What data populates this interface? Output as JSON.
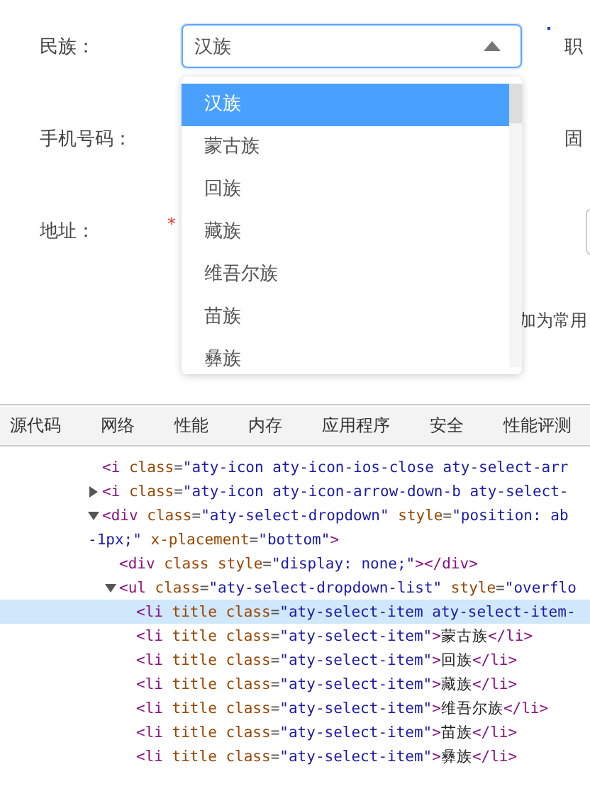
{
  "form": {
    "rows": [
      {
        "label": "民族：",
        "right_label": "职"
      },
      {
        "label": "手机号码：",
        "right_label": "固"
      },
      {
        "label": "地址：",
        "required_mark": "*"
      }
    ],
    "select": {
      "value": "汉族",
      "expanded": true,
      "options": [
        {
          "label": "汉族",
          "selected": true
        },
        {
          "label": "蒙古族",
          "selected": false
        },
        {
          "label": "回族",
          "selected": false
        },
        {
          "label": "藏族",
          "selected": false
        },
        {
          "label": "维吾尔族",
          "selected": false
        },
        {
          "label": "苗族",
          "selected": false
        },
        {
          "label": "彝族",
          "selected": false
        }
      ]
    },
    "hint_text": "加为常用"
  },
  "devtools": {
    "tabs": [
      {
        "label": "源代码",
        "selected": false
      },
      {
        "label": "网络",
        "selected": false
      },
      {
        "label": "性能",
        "selected": false
      },
      {
        "label": "内存",
        "selected": false
      },
      {
        "label": "应用程序",
        "selected": false
      },
      {
        "label": "安全",
        "selected": false
      },
      {
        "label": "性能评测",
        "selected": false
      }
    ],
    "dom_tree": [
      {
        "lines": [
          [
            {
              "kind": "tag",
              "text": "<i"
            },
            {
              "kind": "attr",
              "text": " class"
            },
            {
              "kind": "punct",
              "text": "="
            },
            {
              "kind": "value",
              "text": "\"aty-icon aty-icon-ios-close aty-select-arr"
            }
          ]
        ]
      },
      {
        "expanded": false,
        "lines": [
          [
            {
              "kind": "tag",
              "text": "<i"
            },
            {
              "kind": "attr",
              "text": " class"
            },
            {
              "kind": "punct",
              "text": "="
            },
            {
              "kind": "value",
              "text": "\"aty-icon aty-icon-arrow-down-b aty-select-"
            }
          ]
        ]
      },
      {
        "expanded": true,
        "lines": [
          [
            {
              "kind": "tag",
              "text": "<div"
            },
            {
              "kind": "attr",
              "text": " class"
            },
            {
              "kind": "punct",
              "text": "="
            },
            {
              "kind": "value",
              "text": "\"aty-select-dropdown\""
            },
            {
              "kind": "attr",
              "text": " style"
            },
            {
              "kind": "punct",
              "text": "="
            },
            {
              "kind": "value",
              "text": "\"position: ab"
            }
          ],
          [
            {
              "kind": "value",
              "text": "-1px;\""
            },
            {
              "kind": "attr",
              "text": " x-placement"
            },
            {
              "kind": "punct",
              "text": "="
            },
            {
              "kind": "value",
              "text": "\"bottom\""
            },
            {
              "kind": "tag",
              "text": ">"
            }
          ]
        ],
        "children": [
          {
            "lines": [
              [
                {
                  "kind": "tag",
                  "text": "<div"
                },
                {
                  "kind": "attr",
                  "text": " class style"
                },
                {
                  "kind": "punct",
                  "text": "="
                },
                {
                  "kind": "value",
                  "text": "\"display: none;\""
                },
                {
                  "kind": "tag",
                  "text": "></div>"
                }
              ]
            ]
          },
          {
            "expanded": true,
            "lines": [
              [
                {
                  "kind": "tag",
                  "text": "<ul"
                },
                {
                  "kind": "attr",
                  "text": " class"
                },
                {
                  "kind": "punct",
                  "text": "="
                },
                {
                  "kind": "value",
                  "text": "\"aty-select-dropdown-list\""
                },
                {
                  "kind": "attr",
                  "text": " style"
                },
                {
                  "kind": "punct",
                  "text": "="
                },
                {
                  "kind": "value",
                  "text": "\"overflo"
                }
              ]
            ],
            "children": [
              {
                "selected": true,
                "lines": [
                  [
                    {
                      "kind": "tag",
                      "text": "<li"
                    },
                    {
                      "kind": "attr",
                      "text": " title class"
                    },
                    {
                      "kind": "punct",
                      "text": "="
                    },
                    {
                      "kind": "value",
                      "text": "\"aty-select-item aty-select-item-"
                    }
                  ]
                ]
              },
              {
                "selected": false,
                "lines": [
                  [
                    {
                      "kind": "tag",
                      "text": "<li"
                    },
                    {
                      "kind": "attr",
                      "text": " title class"
                    },
                    {
                      "kind": "punct",
                      "text": "="
                    },
                    {
                      "kind": "value",
                      "text": "\"aty-select-item\""
                    },
                    {
                      "kind": "tag",
                      "text": ">"
                    },
                    {
                      "kind": "text",
                      "text": "蒙古族"
                    },
                    {
                      "kind": "tag",
                      "text": "</li>"
                    }
                  ]
                ]
              },
              {
                "selected": false,
                "lines": [
                  [
                    {
                      "kind": "tag",
                      "text": "<li"
                    },
                    {
                      "kind": "attr",
                      "text": " title class"
                    },
                    {
                      "kind": "punct",
                      "text": "="
                    },
                    {
                      "kind": "value",
                      "text": "\"aty-select-item\""
                    },
                    {
                      "kind": "tag",
                      "text": ">"
                    },
                    {
                      "kind": "text",
                      "text": "回族"
                    },
                    {
                      "kind": "tag",
                      "text": "</li>"
                    }
                  ]
                ]
              },
              {
                "selected": false,
                "lines": [
                  [
                    {
                      "kind": "tag",
                      "text": "<li"
                    },
                    {
                      "kind": "attr",
                      "text": " title class"
                    },
                    {
                      "kind": "punct",
                      "text": "="
                    },
                    {
                      "kind": "value",
                      "text": "\"aty-select-item\""
                    },
                    {
                      "kind": "tag",
                      "text": ">"
                    },
                    {
                      "kind": "text",
                      "text": "藏族"
                    },
                    {
                      "kind": "tag",
                      "text": "</li>"
                    }
                  ]
                ]
              },
              {
                "selected": false,
                "lines": [
                  [
                    {
                      "kind": "tag",
                      "text": "<li"
                    },
                    {
                      "kind": "attr",
                      "text": " title class"
                    },
                    {
                      "kind": "punct",
                      "text": "="
                    },
                    {
                      "kind": "value",
                      "text": "\"aty-select-item\""
                    },
                    {
                      "kind": "tag",
                      "text": ">"
                    },
                    {
                      "kind": "text",
                      "text": "维吾尔族"
                    },
                    {
                      "kind": "tag",
                      "text": "</li>"
                    }
                  ]
                ]
              },
              {
                "selected": false,
                "lines": [
                  [
                    {
                      "kind": "tag",
                      "text": "<li"
                    },
                    {
                      "kind": "attr",
                      "text": " title class"
                    },
                    {
                      "kind": "punct",
                      "text": "="
                    },
                    {
                      "kind": "value",
                      "text": "\"aty-select-item\""
                    },
                    {
                      "kind": "tag",
                      "text": ">"
                    },
                    {
                      "kind": "text",
                      "text": "苗族"
                    },
                    {
                      "kind": "tag",
                      "text": "</li>"
                    }
                  ]
                ]
              },
              {
                "selected": false,
                "lines": [
                  [
                    {
                      "kind": "tag",
                      "text": "<li"
                    },
                    {
                      "kind": "attr",
                      "text": " title class"
                    },
                    {
                      "kind": "punct",
                      "text": "="
                    },
                    {
                      "kind": "value",
                      "text": "\"aty-select-item\""
                    },
                    {
                      "kind": "tag",
                      "text": ">"
                    },
                    {
                      "kind": "text",
                      "text": "彝族"
                    },
                    {
                      "kind": "tag",
                      "text": "</li>"
                    }
                  ]
                ]
              }
            ]
          }
        ]
      }
    ]
  }
}
